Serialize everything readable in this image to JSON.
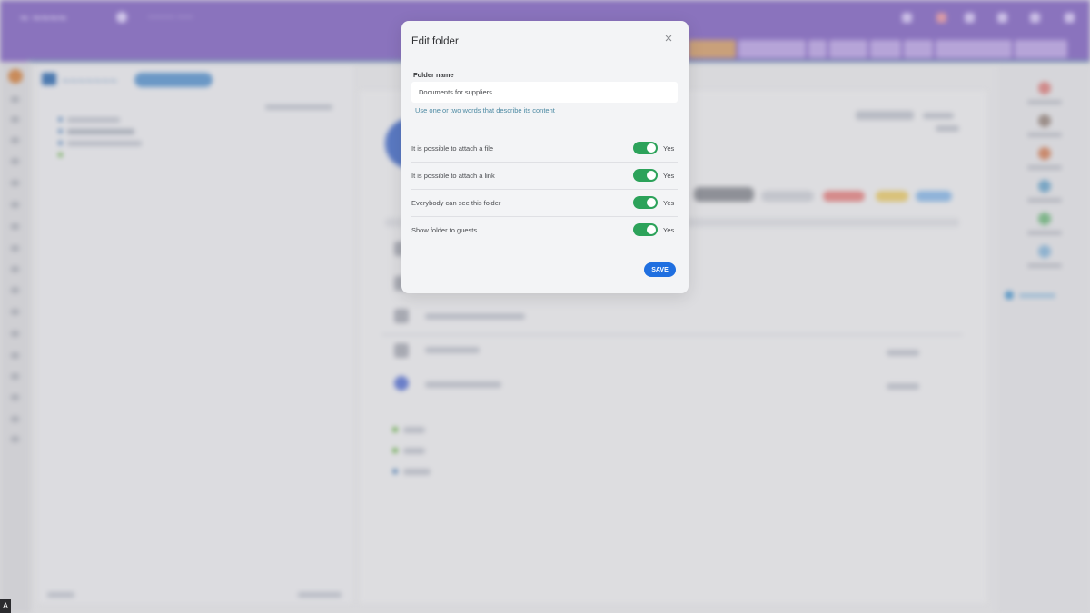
{
  "modal": {
    "title": "Edit folder",
    "close_icon": "×",
    "folder_name_label": "Folder name",
    "folder_name_value": "Documents for suppliers",
    "hint": "Use one or two words that describe its content",
    "options": [
      {
        "label": "It is possible to attach a file",
        "state": "Yes",
        "on": true
      },
      {
        "label": "It is possible to attach a link",
        "state": "Yes",
        "on": true
      },
      {
        "label": "Everybody can see this folder",
        "state": "Yes",
        "on": true
      },
      {
        "label": "Show folder to guests",
        "state": "Yes",
        "on": true
      }
    ],
    "save_label": "SAVE"
  },
  "colors": {
    "toggle_on": "#2ca25a",
    "save_button": "#1f6fe0",
    "header_purple": "#8a73bd"
  }
}
